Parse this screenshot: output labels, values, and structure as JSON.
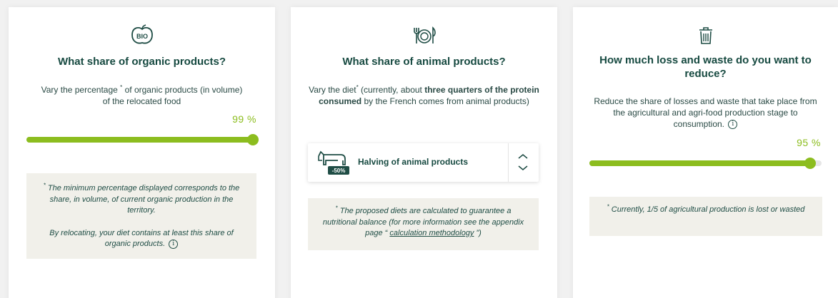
{
  "cards": [
    {
      "icon": "bio-apple-icon",
      "icon_text": "BIO",
      "title": "What share of organic products?",
      "desc_line1": "Vary the percentage",
      "desc_star": "*",
      "desc_line1b": " of organic products (in volume)",
      "desc_line2": "of the relocated food",
      "value_text": "99 %",
      "value": 99,
      "note_star": "*",
      "note_p1": " The minimum percentage displayed corresponds to the share, in volume, of current organic production in the territory.",
      "note_p2": "By relocating, your diet contains at least this share of organic products."
    },
    {
      "icon": "plate-fork-knife-icon",
      "title": "What share of animal products?",
      "desc_a": "Vary the diet",
      "desc_star": "*",
      "desc_b": " (currently, about ",
      "desc_bold": "three quarters of the protein consumed",
      "desc_c": " by the French comes from animal products)",
      "selected_option": "Halving of animal products",
      "badge": "-50%",
      "note_star": "*",
      "note_a": " The proposed diets are calculated to guarantee a nutritional balance (for more information see the appendix page “ ",
      "note_link": "calculation methodology",
      "note_b": " ”)"
    },
    {
      "icon": "trash-bin-icon",
      "title": "How much loss and waste do you want to reduce?",
      "desc": "Reduce the share of losses and waste that take place from the agricultural and agri-food production stage to consumption.",
      "value_text": "95  %",
      "value": 95,
      "note_star": "*",
      "note": " Currently, 1/5 of agricultural production is lost or wasted"
    }
  ],
  "colors": {
    "accent": "#8cbd1f",
    "title": "#174a41",
    "note_bg": "#f1f0ea"
  },
  "info_glyph": "i"
}
